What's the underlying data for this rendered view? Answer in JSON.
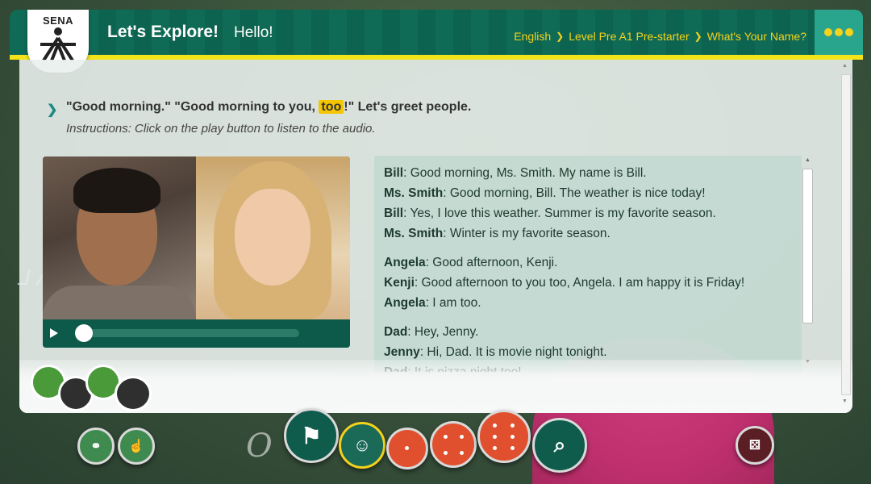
{
  "header": {
    "logo_text": "SENA",
    "title": "Let's Explore!",
    "subtitle": "Hello!",
    "breadcrumb": [
      "English",
      "Level Pre A1 Pre-starter",
      "What's Your Name?"
    ]
  },
  "lesson": {
    "intro_before": "\"Good morning.\" \"Good morning to you, ",
    "intro_highlight": "too",
    "intro_after": "!\" Let's greet people.",
    "instructions": "Instructions: Click on the play button to listen to the audio."
  },
  "dialogue": [
    {
      "speaker": "Bill",
      "text": ": Good morning, Ms. Smith. My name is Bill."
    },
    {
      "speaker": "Ms. Smith",
      "text": ": Good morning, Bill. The weather is nice today!"
    },
    {
      "speaker": "Bill",
      "text": ": Yes, I love this weather. Summer is my favorite season."
    },
    {
      "speaker": "Ms. Smith",
      "text": ": Winter is my favorite season."
    },
    {
      "speaker": "Angela",
      "text": ": Good afternoon, Kenji."
    },
    {
      "speaker": "Kenji",
      "text": ": Good afternoon to you too, Angela. I am happy it is Friday!"
    },
    {
      "speaker": "Angela",
      "text": ": I am too."
    },
    {
      "speaker": "Dad",
      "text": ": Hey, Jenny."
    },
    {
      "speaker": "Jenny",
      "text": ": Hi, Dad. It is movie night tonight."
    },
    {
      "speaker": "Dad",
      "text": ": It is pizza night too!"
    }
  ],
  "player": {
    "progress": 0
  },
  "colors": {
    "header_green": "#0f6b55",
    "accent_yellow": "#f3e31b",
    "breadcrumb_gold": "#f5d21c",
    "highlight": "#f5c500"
  },
  "icons": {
    "menu": "more-dots-icon",
    "play": "play-icon",
    "nav": [
      "flag-icon",
      "boy-face-icon",
      "dice-one-icon",
      "dice-four-icon",
      "dice-six-icon",
      "search-person-icon"
    ],
    "tools": [
      "glossary-icon",
      "touch-letter-icon",
      "photo-dice-icon"
    ]
  }
}
